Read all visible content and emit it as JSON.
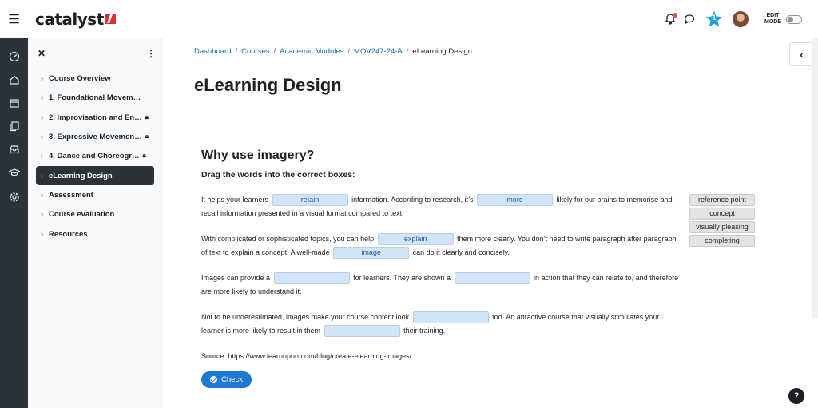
{
  "topbar": {
    "brand": "catalyst",
    "notification_count": "1",
    "edit_mode_line1": "EDIT",
    "edit_mode_line2": "MODE"
  },
  "drawer": {
    "items": [
      {
        "label": "Course Overview",
        "locked": false
      },
      {
        "label": "1. Foundational Movement …",
        "locked": false
      },
      {
        "label": "2. Improvisation and En…",
        "locked": true
      },
      {
        "label": "3. Expressive Movemen…",
        "locked": true
      },
      {
        "label": "4. Dance and Choreogr…",
        "locked": true
      },
      {
        "label": "eLearning Design",
        "locked": false
      },
      {
        "label": "Assessment",
        "locked": false
      },
      {
        "label": "Course evaluation",
        "locked": false
      },
      {
        "label": "Resources",
        "locked": false
      }
    ]
  },
  "breadcrumb": {
    "items": [
      "Dashboard",
      "Courses",
      "Academic Modules",
      "MOV247-24-A"
    ],
    "current": "eLearning Design",
    "separator": "/"
  },
  "page": {
    "title": "eLearning Design"
  },
  "activity": {
    "title": "Why use imagery?",
    "instruction": "Drag the words into the correct boxes:",
    "p1": {
      "a": "It helps your learners",
      "drop1": "retain",
      "b": "information. According to research, it’s",
      "drop2": "more",
      "c": "likely for our brains to memorise and recall information presented in a visual format compared to text."
    },
    "p2": {
      "a": "With complicated or sophisticated topics, you can help",
      "drop1": "explain",
      "b": "them more clearly. You don’t need to write paragraph after paragraph of text to explain a concept. A well-made",
      "drop2": "image",
      "c": "can do it clearly and concisely."
    },
    "p3": {
      "a": "Images can provide a",
      "drop1": "",
      "b": "for learners. They are shown a",
      "drop2": "",
      "c": "in action that they can relate to, and therefore are more likely to understand it."
    },
    "p4": {
      "a": "Not to be underestimated, images make your course content look",
      "drop1": "",
      "b": "too. An attractive course that visually stimulates your learner is more likely to result in them",
      "drop2": "",
      "c": "their training."
    },
    "word_bank": [
      "reference point",
      "concept",
      "visually pleasing",
      "completing"
    ],
    "source": "Source: https://www.learnupon.com/blog/create-elearning-images/",
    "check_label": "Check"
  },
  "help_label": "?",
  "colors": {
    "rail": "#2a3338",
    "link": "#0f6cbf",
    "primary_button": "#1f78d1",
    "drop_zone": "#d3e4f7",
    "brand_red": "#e02d2d",
    "badge": "#1fa3e0"
  },
  "icons": [
    "hamburger-icon",
    "bell-icon",
    "chat-icon",
    "star-badge-icon",
    "gauge-icon",
    "home-icon",
    "calendar-icon",
    "files-icon",
    "inbox-icon",
    "graduation-cap-icon",
    "gear-icon",
    "close-icon",
    "kebab-icon",
    "chevron-right-icon",
    "lock-icon",
    "chevron-left-icon",
    "check-circle-icon",
    "help-icon"
  ]
}
